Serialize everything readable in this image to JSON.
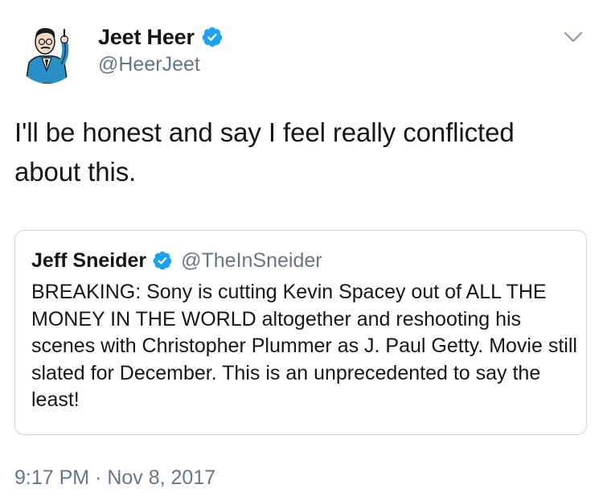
{
  "tweet": {
    "author": {
      "name": "Jeet Heer",
      "handle": "@HeerJeet",
      "verified_icon": "verified-badge-icon",
      "avatar_icon": "cartoon-man-avatar"
    },
    "text": "I'll be honest and say I feel really conflicted about this.",
    "menu_icon": "chevron-down-icon",
    "timestamp": "9:17 PM · Nov 8, 2017"
  },
  "quoted_tweet": {
    "author": {
      "name": "Jeff Sneider",
      "handle": "@TheInSneider"
    },
    "text": "BREAKING: Sony is cutting Kevin Spacey out of ALL THE MONEY IN THE WORLD altogether and reshooting his scenes with Christopher Plummer as J. Paul Getty. Movie still slated for December. This is an unprecedented to say the least!"
  },
  "colors": {
    "text_primary": "#14171a",
    "text_secondary": "#657786",
    "verified_blue": "#1da1f2",
    "border": "#ccd6dd",
    "avatar_suit": "#2b8fc7"
  }
}
